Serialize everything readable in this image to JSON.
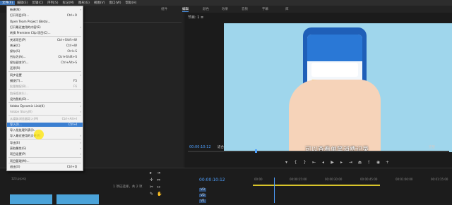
{
  "menubar": {
    "items": [
      "文件(F)",
      "编辑(E)",
      "剪辑(C)",
      "序列(S)",
      "标记(M)",
      "图形(G)",
      "视图(V)",
      "窗口(W)",
      "帮助(H)"
    ]
  },
  "workspaces": [
    "组件",
    "编辑",
    "颜色",
    "效果",
    "音频",
    "字幕",
    "库"
  ],
  "file_menu": {
    "items": [
      {
        "label": "新建(N)",
        "shortcut": "",
        "arrow": true,
        "disabled": false
      },
      {
        "label": "打开项目(O)...",
        "shortcut": "Ctrl+O",
        "arrow": false,
        "disabled": false
      },
      {
        "label": "Open Team Project (Beta)...",
        "shortcut": "",
        "arrow": false,
        "disabled": false
      },
      {
        "label": "打开最近使用的内容(E)",
        "shortcut": "",
        "arrow": true,
        "disabled": false
      },
      {
        "label": "转换 Premiere Clip 项目(C)...",
        "shortcut": "",
        "arrow": false,
        "disabled": false
      },
      {
        "label": "关闭项目(P)",
        "shortcut": "Ctrl+Shift+W",
        "arrow": false,
        "disabled": false
      },
      {
        "label": "关闭(C)",
        "shortcut": "Ctrl+W",
        "arrow": false,
        "disabled": false
      },
      {
        "label": "保存(S)",
        "shortcut": "Ctrl+S",
        "arrow": false,
        "disabled": false
      },
      {
        "label": "另存为(A)...",
        "shortcut": "Ctrl+Shift+S",
        "arrow": false,
        "disabled": false
      },
      {
        "label": "保存副本(Y)...",
        "shortcut": "Ctrl+Alt+S",
        "arrow": false,
        "disabled": false
      },
      {
        "label": "还原(R)",
        "shortcut": "",
        "arrow": false,
        "disabled": false
      },
      {
        "label": "同步设置",
        "shortcut": "",
        "arrow": true,
        "disabled": false
      },
      {
        "label": "捕捉(T)...",
        "shortcut": "F5",
        "arrow": false,
        "disabled": false
      },
      {
        "label": "批量捕捉(B)...",
        "shortcut": "F6",
        "arrow": false,
        "disabled": true
      },
      {
        "label": "链接媒体(L)...",
        "shortcut": "",
        "arrow": false,
        "disabled": true
      },
      {
        "label": "设为脱机(O)...",
        "shortcut": "",
        "arrow": false,
        "disabled": false
      },
      {
        "label": "Adobe Dynamic Link(K)",
        "shortcut": "",
        "arrow": true,
        "disabled": false
      },
      {
        "label": "Adobe Story(R)",
        "shortcut": "",
        "arrow": true,
        "disabled": true
      },
      {
        "label": "从媒体浏览器导入(M)",
        "shortcut": "Ctrl+Alt+I",
        "arrow": false,
        "disabled": true
      },
      {
        "label": "导入(I)...",
        "shortcut": "Ctrl+I",
        "arrow": false,
        "disabled": false,
        "highlight": true
      },
      {
        "label": "导入批处理列表(I)...",
        "shortcut": "",
        "arrow": false,
        "disabled": false
      },
      {
        "label": "导入最近使用的文件(F)",
        "shortcut": "",
        "arrow": true,
        "disabled": false
      },
      {
        "label": "导出(E)",
        "shortcut": "",
        "arrow": true,
        "disabled": false
      },
      {
        "label": "获取属性(G)",
        "shortcut": "",
        "arrow": true,
        "disabled": false
      },
      {
        "label": "项目设置(P)",
        "shortcut": "",
        "arrow": true,
        "disabled": false
      },
      {
        "label": "项目管理(M)...",
        "shortcut": "",
        "arrow": false,
        "disabled": false
      },
      {
        "label": "退出(X)",
        "shortcut": "Ctrl+Q",
        "arrow": false,
        "disabled": false
      }
    ]
  },
  "program_monitor": {
    "title": "节目: 1 ≡",
    "subtitle_text": "可以查看单笔消费记录",
    "timecode": "00:00:10:12",
    "fit": "适合",
    "quality": "完整"
  },
  "project_panel": {
    "name": "123.prproj",
    "info": "1 项已选择，共 2 项"
  },
  "timeline": {
    "timecode": "00:00:10:12",
    "ruler": [
      "00:00",
      "00:00:15:00",
      "00:00:30:00",
      "00:00:45:00",
      "00:01:00:00",
      "00:01:15:00"
    ],
    "tracks": [
      "V3",
      "V2",
      "V1"
    ]
  },
  "colors": {
    "accent": "#4ea0ff",
    "highlight": "#3b7fd1"
  }
}
